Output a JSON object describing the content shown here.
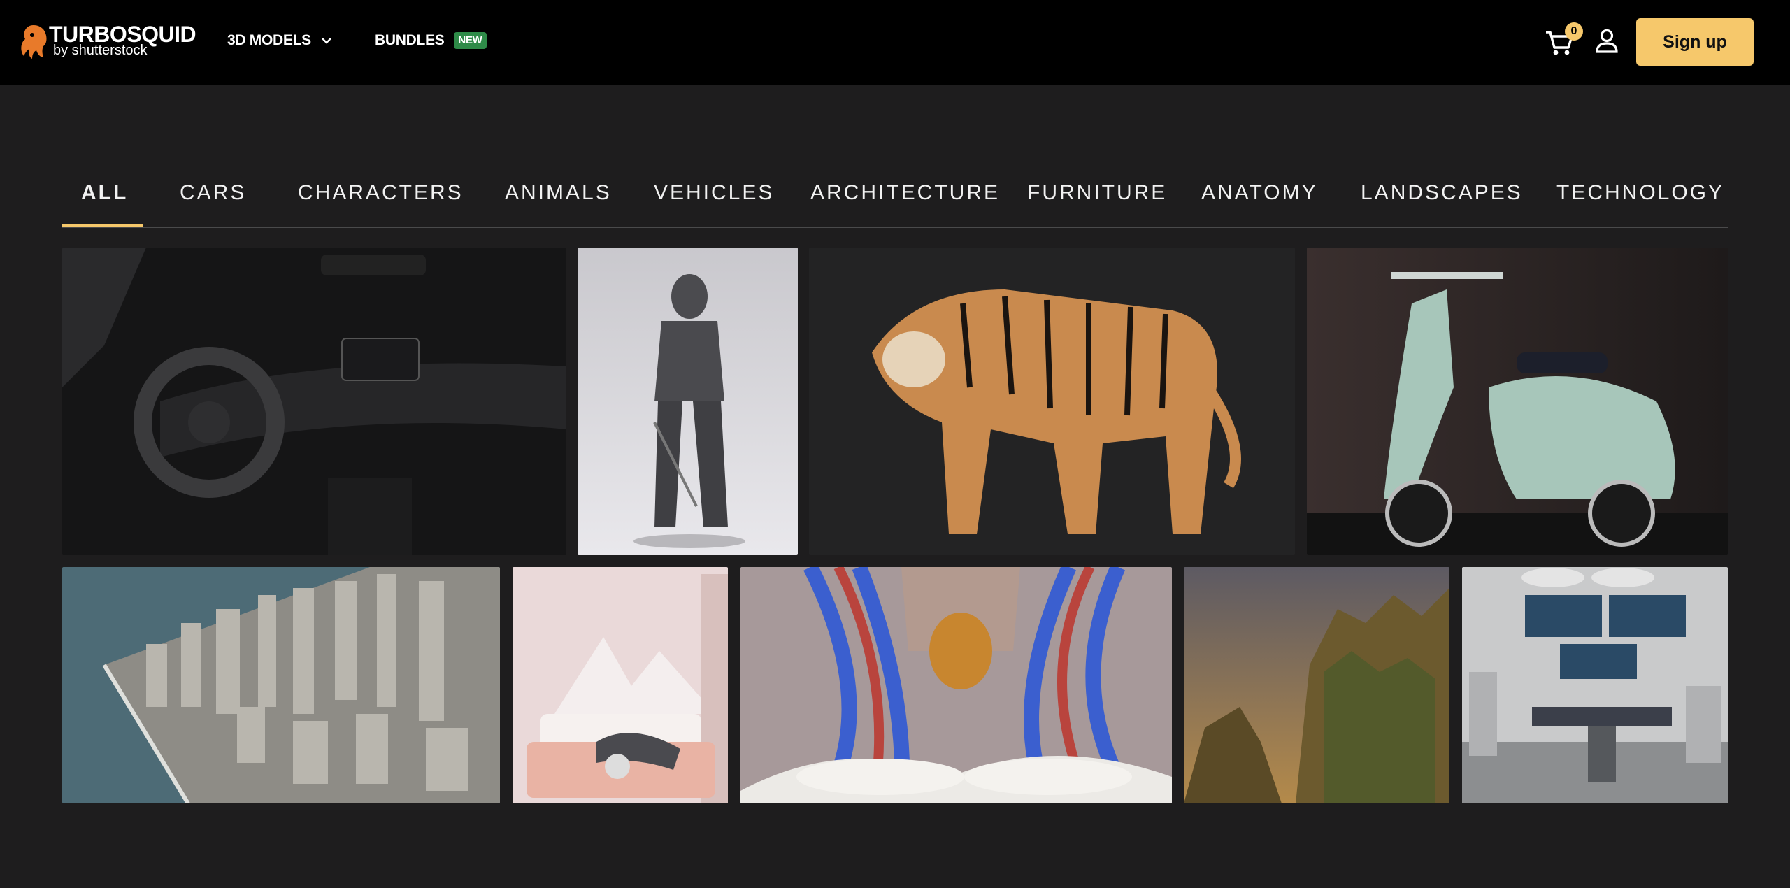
{
  "header": {
    "logo": {
      "wordmark": "TURBOSQUID",
      "byline": "by shutterstock"
    },
    "nav": [
      {
        "label": "3D MODELS",
        "icon": "chevron-down-icon"
      },
      {
        "label": "BUNDLES",
        "badge": "NEW"
      }
    ],
    "cart": {
      "count": "0",
      "icon": "cart-icon"
    },
    "account_icon": "user-icon",
    "signup_label": "Sign up"
  },
  "tabs": [
    {
      "label": "ALL",
      "active": true
    },
    {
      "label": "CARS"
    },
    {
      "label": "CHARACTERS"
    },
    {
      "label": "ANIMALS"
    },
    {
      "label": "VEHICLES"
    },
    {
      "label": "ARCHITECTURE"
    },
    {
      "label": "FURNITURE"
    },
    {
      "label": "ANATOMY"
    },
    {
      "label": "LANDSCAPES"
    },
    {
      "label": "TECHNOLOGY"
    }
  ],
  "gallery": [
    {
      "subject": "car interior"
    },
    {
      "subject": "armored knight"
    },
    {
      "subject": "tiger"
    },
    {
      "subject": "scooter"
    },
    {
      "subject": "city aerial"
    },
    {
      "subject": "bedroom"
    },
    {
      "subject": "anatomy"
    },
    {
      "subject": "landscape cliffs"
    },
    {
      "subject": "operating room"
    }
  ],
  "colors": {
    "accent": "#f6c86b",
    "background": "#1e1d1e",
    "header": "#000000",
    "badge": "#2e8b48"
  }
}
